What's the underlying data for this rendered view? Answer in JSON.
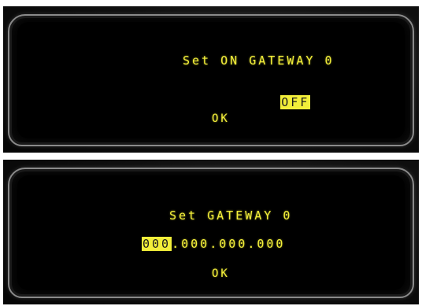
{
  "panel_top": {
    "title": "Set ON GATEWAY 0",
    "value": "OFF",
    "ok_label": "OK"
  },
  "panel_bottom": {
    "title": "Set GATEWAY 0",
    "ip_octet_1": "000",
    "ip_rest": ".000.000.000",
    "ok_label": "OK"
  },
  "colors": {
    "lcd_text": "#f2ee3a",
    "highlight_text": "#1b1b1b",
    "screen_bg": "#000000"
  }
}
